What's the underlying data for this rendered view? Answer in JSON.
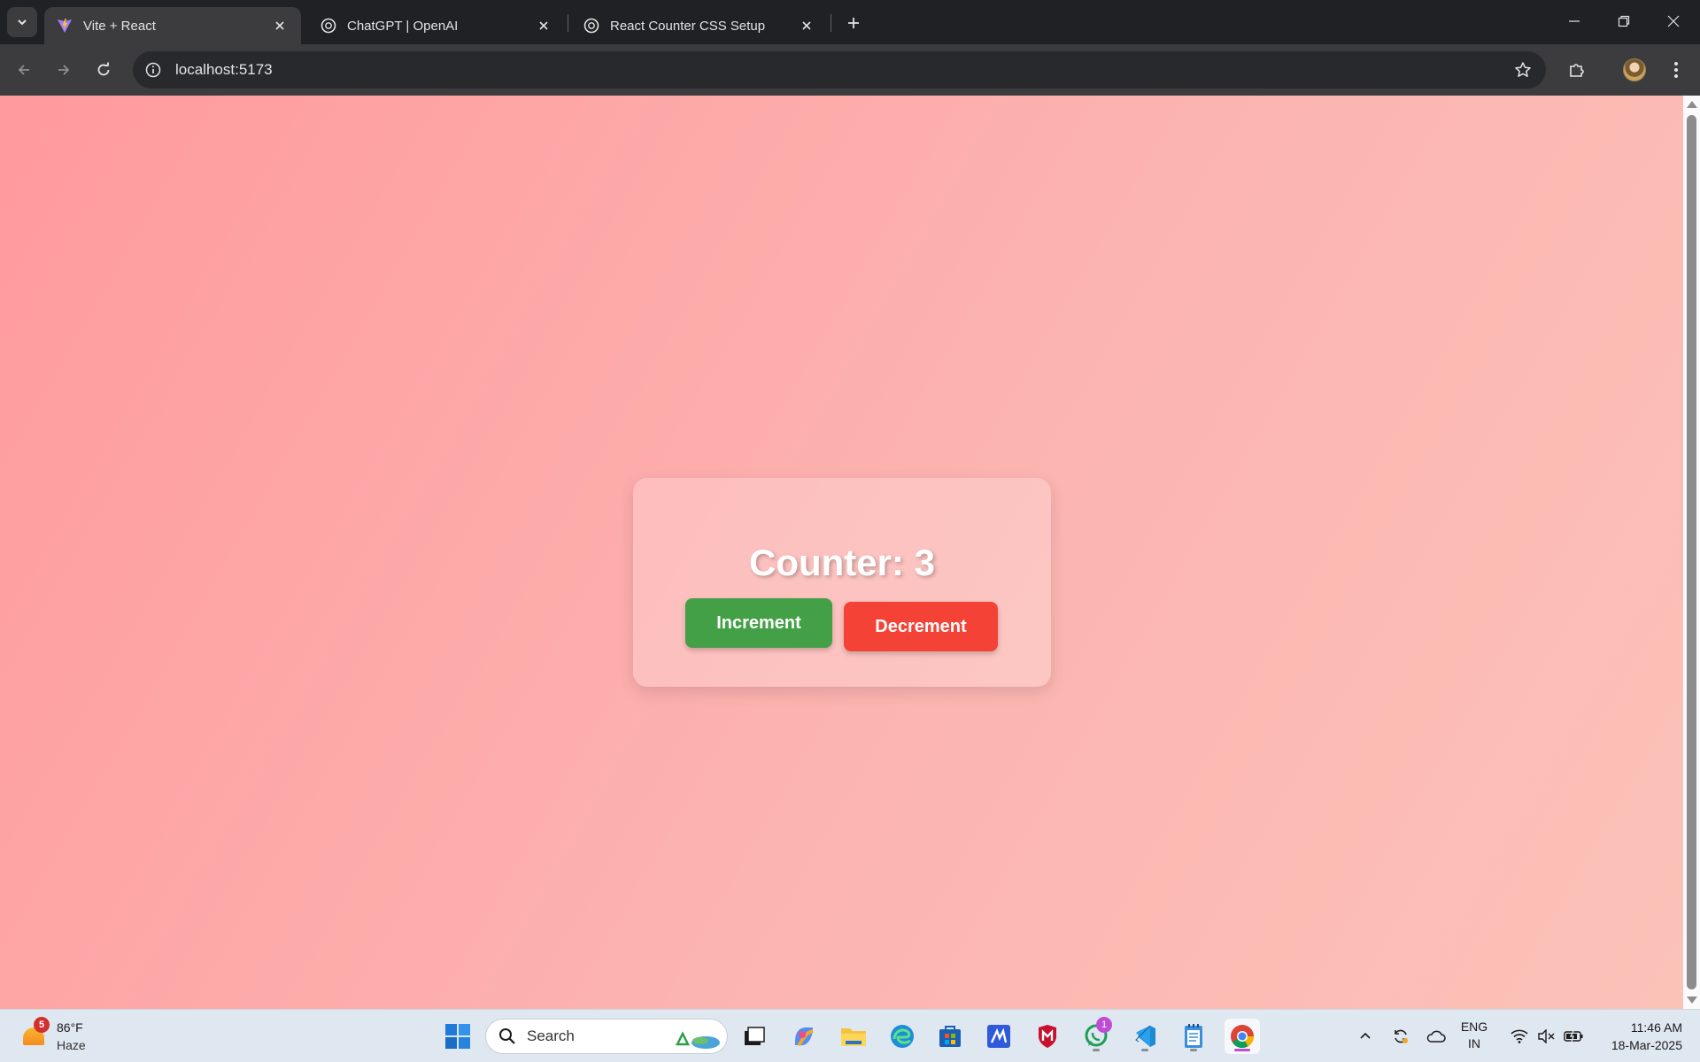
{
  "browser": {
    "tabs": [
      {
        "title": "Vite + React",
        "active": true,
        "favicon": "vite-icon"
      },
      {
        "title": "ChatGPT | OpenAI",
        "active": false,
        "favicon": "openai-icon"
      },
      {
        "title": "React Counter CSS Setup",
        "active": false,
        "favicon": "openai-icon"
      }
    ],
    "address": {
      "url": "localhost:5173"
    }
  },
  "page": {
    "counter_label": "Counter: 3",
    "increment_label": "Increment",
    "decrement_label": "Decrement",
    "colors": {
      "increment": "#43a047",
      "decrement": "#f44336",
      "bg_start": "#ff9a9e",
      "bg_end": "#fbc2b8"
    }
  },
  "taskbar": {
    "weather": {
      "temp": "86°F",
      "condition": "Haze",
      "badge": "5"
    },
    "search_label": "Search",
    "whatsapp_badge": "1",
    "lang": {
      "line1": "ENG",
      "line2": "IN"
    },
    "clock": {
      "time": "11:46 AM",
      "date": "18-Mar-2025"
    }
  }
}
